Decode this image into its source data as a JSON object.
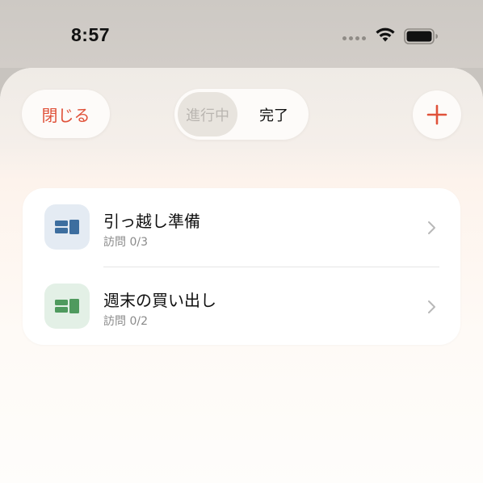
{
  "status_bar": {
    "time": "8:57"
  },
  "header": {
    "close_label": "閉じる",
    "segments": [
      {
        "label": "進行中",
        "selected": true
      },
      {
        "label": "完了",
        "selected": false
      }
    ],
    "add_icon": "plus-icon"
  },
  "list": {
    "items": [
      {
        "title": "引っ越し準備",
        "subtitle": "訪問 0/3",
        "icon": "map-blocks-icon",
        "icon_color": "#3d6e9f",
        "icon_bg": "#e4ebf3"
      },
      {
        "title": "週末の買い出し",
        "subtitle": "訪問 0/2",
        "icon": "map-blocks-icon",
        "icon_color": "#4f9a5e",
        "icon_bg": "#e3f0e6"
      }
    ]
  },
  "colors": {
    "accent": "#e0523a"
  }
}
